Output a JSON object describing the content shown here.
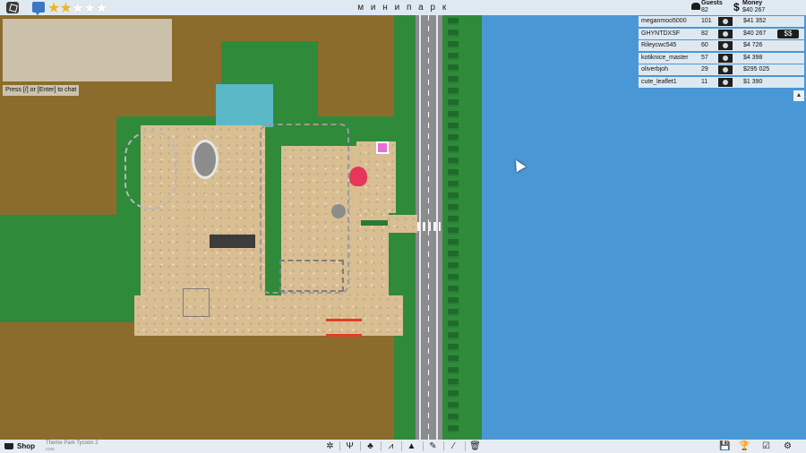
{
  "top_bar": {
    "park_name": "м и н и п а р к",
    "rating": {
      "value": 2,
      "max": 5
    },
    "icons": [
      "roblox-menu-icon",
      "chat-icon"
    ]
  },
  "chat": {
    "hint": "Press [/] or [Enter] to chat"
  },
  "stats": {
    "guests_label": "Guests",
    "guests_value": "82",
    "money_label": "Money",
    "money_symbol": "$",
    "money_value": "$40 267"
  },
  "leaderboard": {
    "rows": [
      {
        "name": "meganmoo5000",
        "guests": "101",
        "money": "$41 352"
      },
      {
        "name": "GHYNTDXSF",
        "guests": "82",
        "money": "$40 267"
      },
      {
        "name": "Rileycwc545",
        "guests": "60",
        "money": "$4 726"
      },
      {
        "name": "kotiknice_master",
        "guests": "57",
        "money": "$4 398"
      },
      {
        "name": "oliverbjoh",
        "guests": "29",
        "money": "$295 025"
      },
      {
        "name": "cute_leaflet1",
        "guests": "11",
        "money": "$1 390"
      }
    ],
    "collapse_glyph": "▲"
  },
  "bottom_bar": {
    "shop_label": "Shop",
    "game_title": "Theme Park Tycoon 2",
    "game_version": "v346",
    "tools": [
      {
        "name": "rides-tool",
        "glyph": "✲"
      },
      {
        "name": "food-tool",
        "glyph": "Ψ"
      },
      {
        "name": "scenery-tool",
        "glyph": "♣"
      },
      {
        "name": "coaster-tool",
        "glyph": "⩘"
      },
      {
        "name": "terrain-tool",
        "glyph": "▲"
      },
      {
        "name": "path-tool",
        "glyph": "✎"
      },
      {
        "name": "paint-tool",
        "glyph": "⁄"
      },
      {
        "name": "delete-tool",
        "glyph": "🗑"
      },
      {
        "name": "save-tool",
        "glyph": "💾"
      },
      {
        "name": "awards-tool",
        "glyph": "🏆"
      },
      {
        "name": "objectives-tool",
        "glyph": "☑"
      },
      {
        "name": "settings-tool",
        "glyph": "⚙"
      }
    ]
  },
  "colors": {
    "dirt": "#8c6c2c",
    "grass": "#2f8a3a",
    "water": "#4a97d6",
    "road": "#8b8c90",
    "star_filled": "#f0b429"
  }
}
